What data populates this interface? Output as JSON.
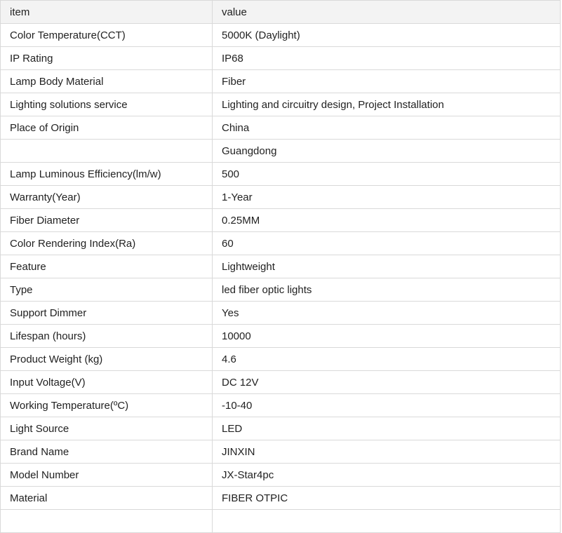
{
  "table": {
    "headers": [
      "item",
      "value"
    ],
    "rows": [
      [
        "Color Temperature(CCT)",
        "5000K (Daylight)"
      ],
      [
        "IP Rating",
        "IP68"
      ],
      [
        "Lamp Body Material",
        "Fiber"
      ],
      [
        "Lighting solutions service",
        "Lighting and circuitry design, Project Installation"
      ],
      [
        "Place of Origin",
        "China"
      ],
      [
        "",
        "Guangdong"
      ],
      [
        "Lamp Luminous Efficiency(lm/w)",
        "500"
      ],
      [
        "Warranty(Year)",
        "1-Year"
      ],
      [
        "Fiber Diameter",
        "0.25MM"
      ],
      [
        "Color Rendering Index(Ra)",
        "60"
      ],
      [
        "Feature",
        "Lightweight"
      ],
      [
        "Type",
        "led fiber optic lights"
      ],
      [
        "Support Dimmer",
        "Yes"
      ],
      [
        "Lifespan (hours)",
        "10000"
      ],
      [
        "Product Weight  (kg)",
        "4.6"
      ],
      [
        "Input Voltage(V)",
        "DC 12V"
      ],
      [
        "Working Temperature(ºC)",
        "-10-40"
      ],
      [
        "Light Source",
        "LED"
      ],
      [
        "Brand Name",
        "JINXIN"
      ],
      [
        "Model Number",
        "JX-Star4pc"
      ],
      [
        "Material",
        "FIBER OTPIC"
      ],
      [
        "",
        ""
      ]
    ]
  }
}
